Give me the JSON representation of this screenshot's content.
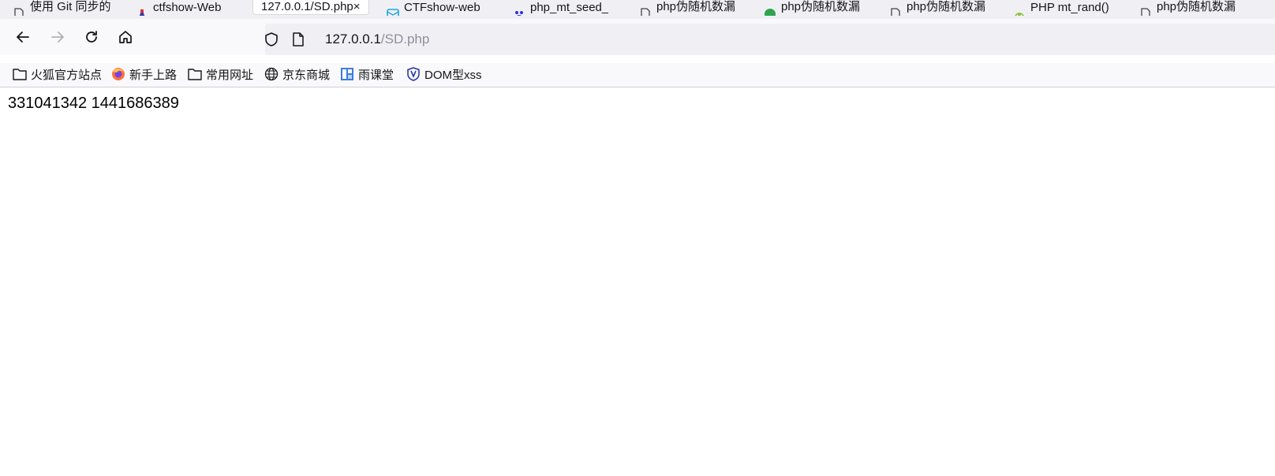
{
  "tabs": [
    {
      "title": "使用 Git 同步的",
      "icon": "page-icon"
    },
    {
      "title": "ctfshow-Web",
      "icon": "ctfshow-icon"
    },
    {
      "title": "127.0.0.1/SD.php",
      "icon": "none",
      "active": true,
      "close": "×"
    },
    {
      "title": "CTFshow-web",
      "icon": "mail-icon"
    },
    {
      "title": "php_mt_seed_",
      "icon": "baidu-icon"
    },
    {
      "title": "php伪随机数漏",
      "icon": "page-icon"
    },
    {
      "title": "php伪随机数漏",
      "icon": "green-circle-icon"
    },
    {
      "title": "php伪随机数漏",
      "icon": "page-icon"
    },
    {
      "title": "PHP mt_rand()",
      "icon": "android-icon"
    },
    {
      "title": "php伪随机数漏",
      "icon": "page-icon"
    }
  ],
  "url": {
    "host": "127.0.0.1",
    "path": "/SD.php"
  },
  "bookmarks": [
    {
      "label": "火狐官方站点",
      "icon": "folder-icon"
    },
    {
      "label": "新手上路",
      "icon": "firefox-icon"
    },
    {
      "label": "常用网址",
      "icon": "folder-icon"
    },
    {
      "label": "京东商城",
      "icon": "globe-icon"
    },
    {
      "label": "雨课堂",
      "icon": "yuketang-icon"
    },
    {
      "label": "DOM型xss",
      "icon": "shield-badge-icon"
    }
  ],
  "page": {
    "output": "331041342 1441686389"
  },
  "colors": {
    "tabstrip": "#f0f0f4",
    "toolbar": "#f9f9fb",
    "urlbar": "#f0f0f4",
    "text": "#15141a",
    "muted": "#8f8f9d"
  }
}
